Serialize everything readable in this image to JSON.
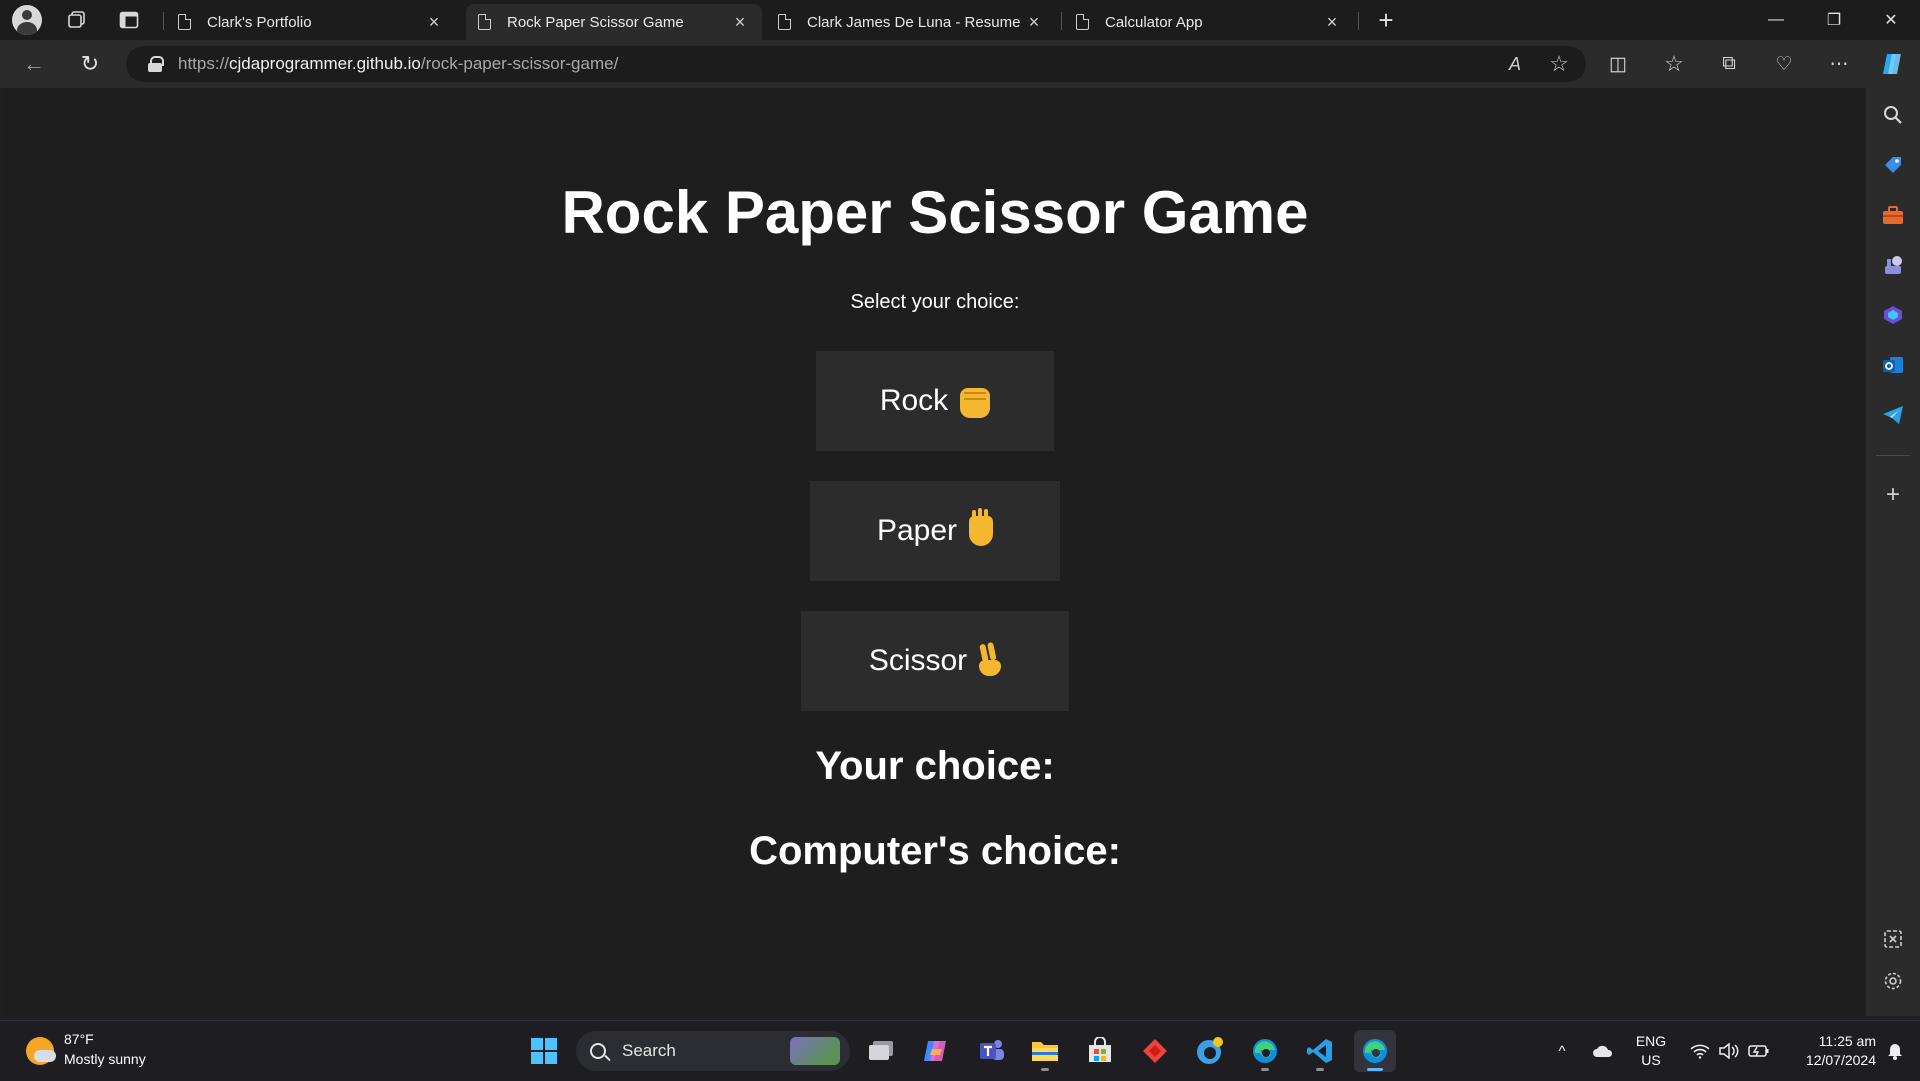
{
  "browser": {
    "tabs": [
      {
        "title": "Clark's Portfolio",
        "active": false
      },
      {
        "title": "Rock Paper Scissor Game",
        "active": true
      },
      {
        "title": "Clark James De Luna - Resume",
        "active": false
      },
      {
        "title": "Calculator App",
        "active": false
      }
    ],
    "new_tab_glyph": "+",
    "close_glyph": "×",
    "window_controls": {
      "minimize": "—",
      "restore": "❐",
      "close": "✕"
    },
    "url": {
      "prefix": "https://",
      "host": "cjdaprogrammer.github.io",
      "path": "/rock-paper-scissor-game/"
    },
    "nav": {
      "back_glyph": "←",
      "refresh_glyph": "↻"
    },
    "address_icons": {
      "read_aloud": "A",
      "favorite": "☆"
    },
    "toolbar_icons": {
      "split_screen": "◫",
      "favorites": "☆",
      "collections": "⧉",
      "performance": "♡",
      "more": "⋯",
      "copilot": "copilot-icon"
    }
  },
  "page": {
    "title": "Rock Paper Scissor Game",
    "prompt": "Select your choice:",
    "choices": [
      {
        "label": "Rock",
        "emoji": "fist-icon"
      },
      {
        "label": "Paper",
        "emoji": "raised-hand-icon"
      },
      {
        "label": "Scissor",
        "emoji": "victory-hand-icon"
      }
    ],
    "your_choice_label": "Your choice:",
    "computer_choice_label": "Computer's choice:"
  },
  "sidebar": {
    "icons": [
      "search-icon",
      "shopping-tag-icon",
      "tools-briefcase-icon",
      "games-icon",
      "microsoft-365-icon",
      "outlook-icon",
      "telegram-icon"
    ],
    "add_glyph": "+",
    "bottom_icons": [
      "screenshot-icon",
      "settings-icon"
    ]
  },
  "taskbar": {
    "weather": {
      "temp": "87°F",
      "condition": "Mostly sunny"
    },
    "search_label": "Search",
    "apps": [
      "windows-start-icon",
      "task-view-icon",
      "copilot-icon",
      "teams-icon",
      "file-explorer-icon",
      "microsoft-store-icon",
      "anydesk-icon",
      "edge-beta-icon",
      "edge-icon",
      "vscode-icon",
      "edge-active-icon"
    ],
    "tray": {
      "chevron": "^",
      "lang_top": "ENG",
      "lang_bottom": "US",
      "time": "11:25 am",
      "date": "12/07/2024"
    }
  },
  "colors": {
    "page_bg": "#1e1e1e",
    "button_bg": "#2c2c2c",
    "emoji_yellow": "#f4b72f",
    "accent": "#5cb8ff"
  }
}
